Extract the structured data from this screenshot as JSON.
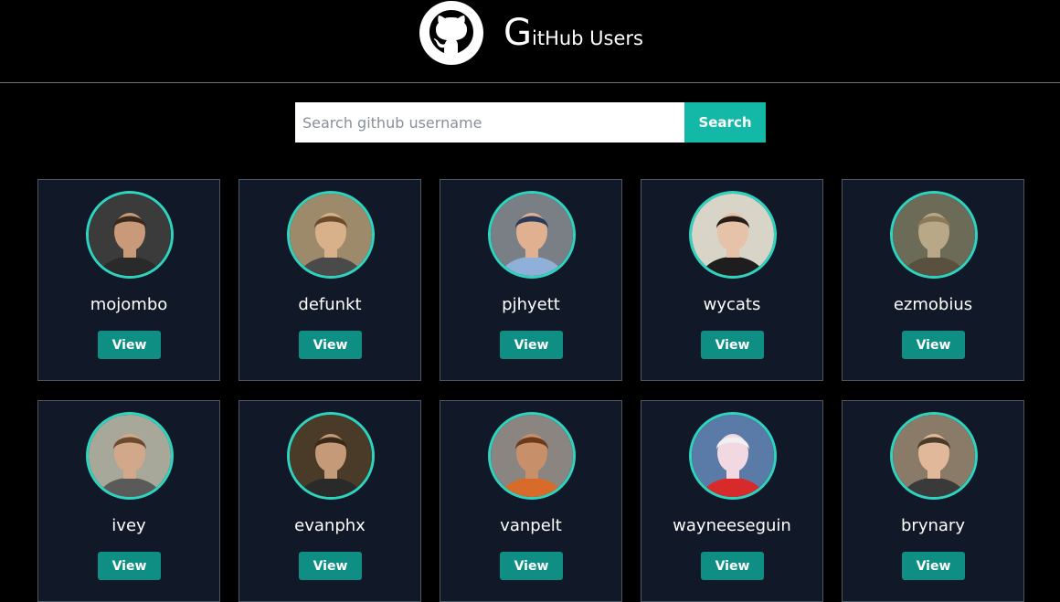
{
  "header": {
    "brand_initial": "G",
    "brand_rest": "itHub Users",
    "logo_icon": "github-octocat-icon"
  },
  "search": {
    "placeholder": "Search github username",
    "value": "",
    "button_label": "Search"
  },
  "colors": {
    "accent": "#14b8a6",
    "avatar_ring": "#2dd4bf",
    "view_button": "#0f8f83",
    "card_bg": "#111827"
  },
  "users": [
    {
      "username": "mojombo",
      "view_label": "View",
      "avatar": {
        "bg": "#3b3b3b",
        "skin": "#c99a7a",
        "hair": "#3a2a1e",
        "shirt": "#2a2a2a"
      }
    },
    {
      "username": "defunkt",
      "view_label": "View",
      "avatar": {
        "bg": "#9c8a6a",
        "skin": "#d8b08a",
        "hair": "#6b4a2a",
        "shirt": "#4a4a4a"
      }
    },
    {
      "username": "pjhyett",
      "view_label": "View",
      "avatar": {
        "bg": "#7a7f86",
        "skin": "#e0b090",
        "hair": "#2a3a5a",
        "shirt": "#8fb0d8"
      }
    },
    {
      "username": "wycats",
      "view_label": "View",
      "avatar": {
        "bg": "#d8d4c8",
        "skin": "#e6c2a8",
        "hair": "#2a1e18",
        "shirt": "#1e1e1e"
      }
    },
    {
      "username": "ezmobius",
      "view_label": "View",
      "avatar": {
        "bg": "#6b6b58",
        "skin": "#b8a888",
        "hair": "#8a7a5a",
        "shirt": "#5a5040"
      }
    },
    {
      "username": "ivey",
      "view_label": "View",
      "avatar": {
        "bg": "#a8a89a",
        "skin": "#d2a88a",
        "hair": "#6b4a30",
        "shirt": "#5a5a58"
      }
    },
    {
      "username": "evanphx",
      "view_label": "View",
      "avatar": {
        "bg": "#4a3a28",
        "skin": "#c49a78",
        "hair": "#3a2818",
        "shirt": "#2a2a2a"
      }
    },
    {
      "username": "vanpelt",
      "view_label": "View",
      "avatar": {
        "bg": "#8a8580",
        "skin": "#c8906a",
        "hair": "#6a3a1a",
        "shirt": "#d86a2a"
      }
    },
    {
      "username": "wayneeseguin",
      "view_label": "View",
      "avatar": {
        "bg": "#5a7aa8",
        "skin": "#f2d8e0",
        "hair": "#f0f0f0",
        "shirt": "#d82a2a"
      }
    },
    {
      "username": "brynary",
      "view_label": "View",
      "avatar": {
        "bg": "#8a7a68",
        "skin": "#e2b89a",
        "hair": "#4a3a2a",
        "shirt": "#3a3a3a"
      }
    }
  ]
}
